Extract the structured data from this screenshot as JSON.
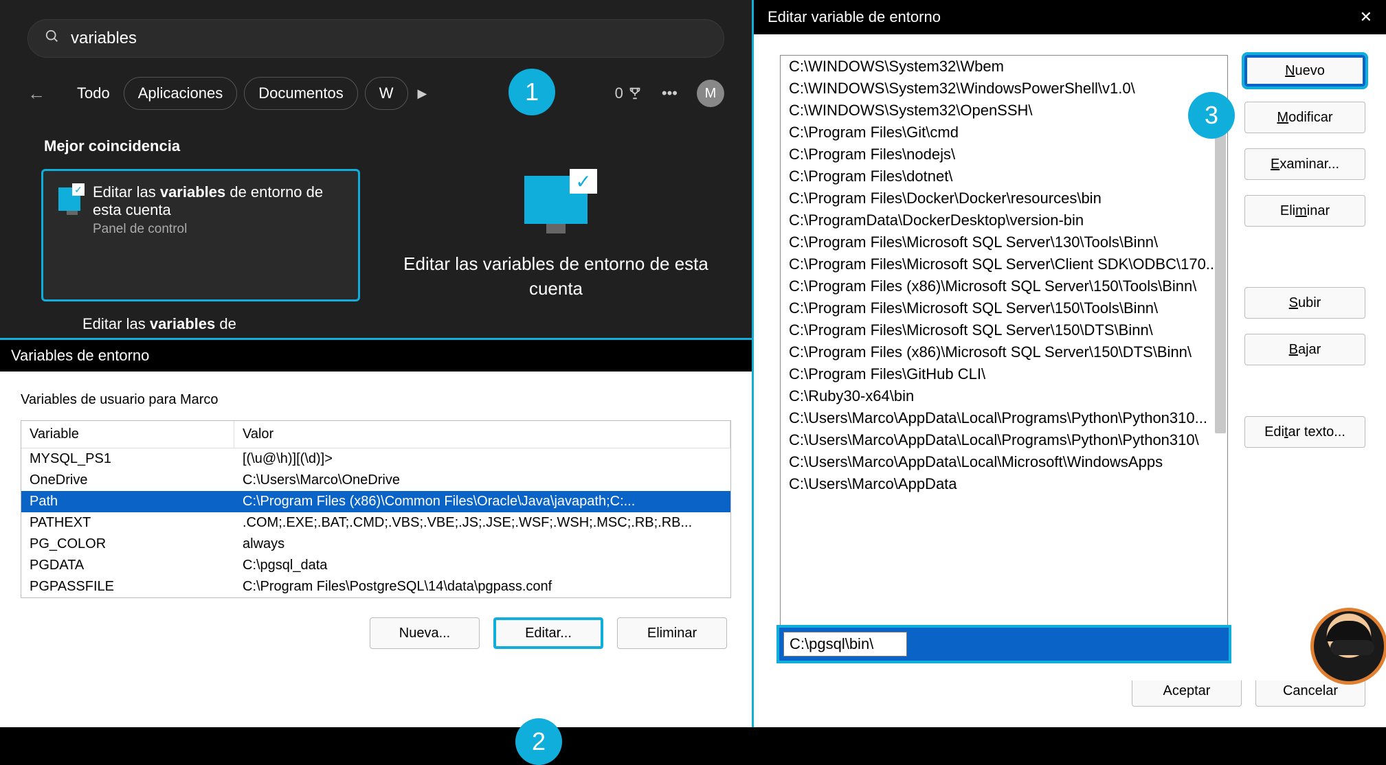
{
  "search": {
    "query": "variables",
    "tabs": [
      "Todo",
      "Aplicaciones",
      "Documentos",
      "W"
    ],
    "score": "0",
    "avatar_initial": "M",
    "best_match_label": "Mejor coincidencia",
    "result": {
      "line_prefix": "Editar las ",
      "line_bold": "variables",
      "line_suffix": " de entorno de esta cuenta",
      "sub": "Panel de control"
    },
    "secondary_prefix": "Editar las ",
    "secondary_bold": "variables",
    "secondary_suffix": " de",
    "preview_title": "Editar las variables de entorno de esta cuenta"
  },
  "env_dialog": {
    "title": "Variables de entorno",
    "user_section": "Variables de usuario para Marco",
    "columns": {
      "variable": "Variable",
      "value": "Valor"
    },
    "rows": [
      {
        "var": "MYSQL_PS1",
        "val": "[(\\u@\\h)][(\\d)]>"
      },
      {
        "var": "OneDrive",
        "val": "C:\\Users\\Marco\\OneDrive"
      },
      {
        "var": "Path",
        "val": "C:\\Program Files (x86)\\Common Files\\Oracle\\Java\\javapath;C:...",
        "selected": true
      },
      {
        "var": "PATHEXT",
        "val": ".COM;.EXE;.BAT;.CMD;.VBS;.VBE;.JS;.JSE;.WSF;.WSH;.MSC;.RB;.RB..."
      },
      {
        "var": "PG_COLOR",
        "val": "always"
      },
      {
        "var": "PGDATA",
        "val": "C:\\pgsql_data"
      },
      {
        "var": "PGPASSFILE",
        "val": "C:\\Program Files\\PostgreSQL\\14\\data\\pgpass.conf"
      }
    ],
    "buttons": {
      "new": "Nueva...",
      "edit": "Editar...",
      "delete": "Eliminar"
    }
  },
  "edit_dialog": {
    "title": "Editar variable de entorno",
    "paths": [
      "C:\\WINDOWS\\System32\\Wbem",
      "C:\\WINDOWS\\System32\\WindowsPowerShell\\v1.0\\",
      "C:\\WINDOWS\\System32\\OpenSSH\\",
      "C:\\Program Files\\Git\\cmd",
      "C:\\Program Files\\nodejs\\",
      "C:\\Program Files\\dotnet\\",
      "C:\\Program Files\\Docker\\Docker\\resources\\bin",
      "C:\\ProgramData\\DockerDesktop\\version-bin",
      "C:\\Program Files\\Microsoft SQL Server\\130\\Tools\\Binn\\",
      "C:\\Program Files\\Microsoft SQL Server\\Client SDK\\ODBC\\170...",
      "C:\\Program Files (x86)\\Microsoft SQL Server\\150\\Tools\\Binn\\",
      "C:\\Program Files\\Microsoft SQL Server\\150\\Tools\\Binn\\",
      "C:\\Program Files\\Microsoft SQL Server\\150\\DTS\\Binn\\",
      "C:\\Program Files (x86)\\Microsoft SQL Server\\150\\DTS\\Binn\\",
      "C:\\Program Files\\GitHub CLI\\",
      "C:\\Ruby30-x64\\bin",
      "C:\\Users\\Marco\\AppData\\Local\\Programs\\Python\\Python310...",
      "C:\\Users\\Marco\\AppData\\Local\\Programs\\Python\\Python310\\",
      "C:\\Users\\Marco\\AppData\\Local\\Microsoft\\WindowsApps",
      "C:\\Users\\Marco\\AppData"
    ],
    "editing_value": "C:\\pgsql\\bin\\",
    "buttons": {
      "new": "Nuevo",
      "modify": "Modificar",
      "browse": "Examinar...",
      "delete": "Eliminar",
      "up": "Subir",
      "down": "Bajar",
      "edit_text": "Editar texto...",
      "ok": "Aceptar",
      "cancel": "Cancelar"
    },
    "underlines": {
      "new": "N",
      "modify": "M",
      "browse": "E",
      "delete": "m",
      "up": "S",
      "down": "B",
      "edit_text": "t"
    }
  },
  "steps": {
    "s1": "1",
    "s2": "2",
    "s3": "3"
  }
}
